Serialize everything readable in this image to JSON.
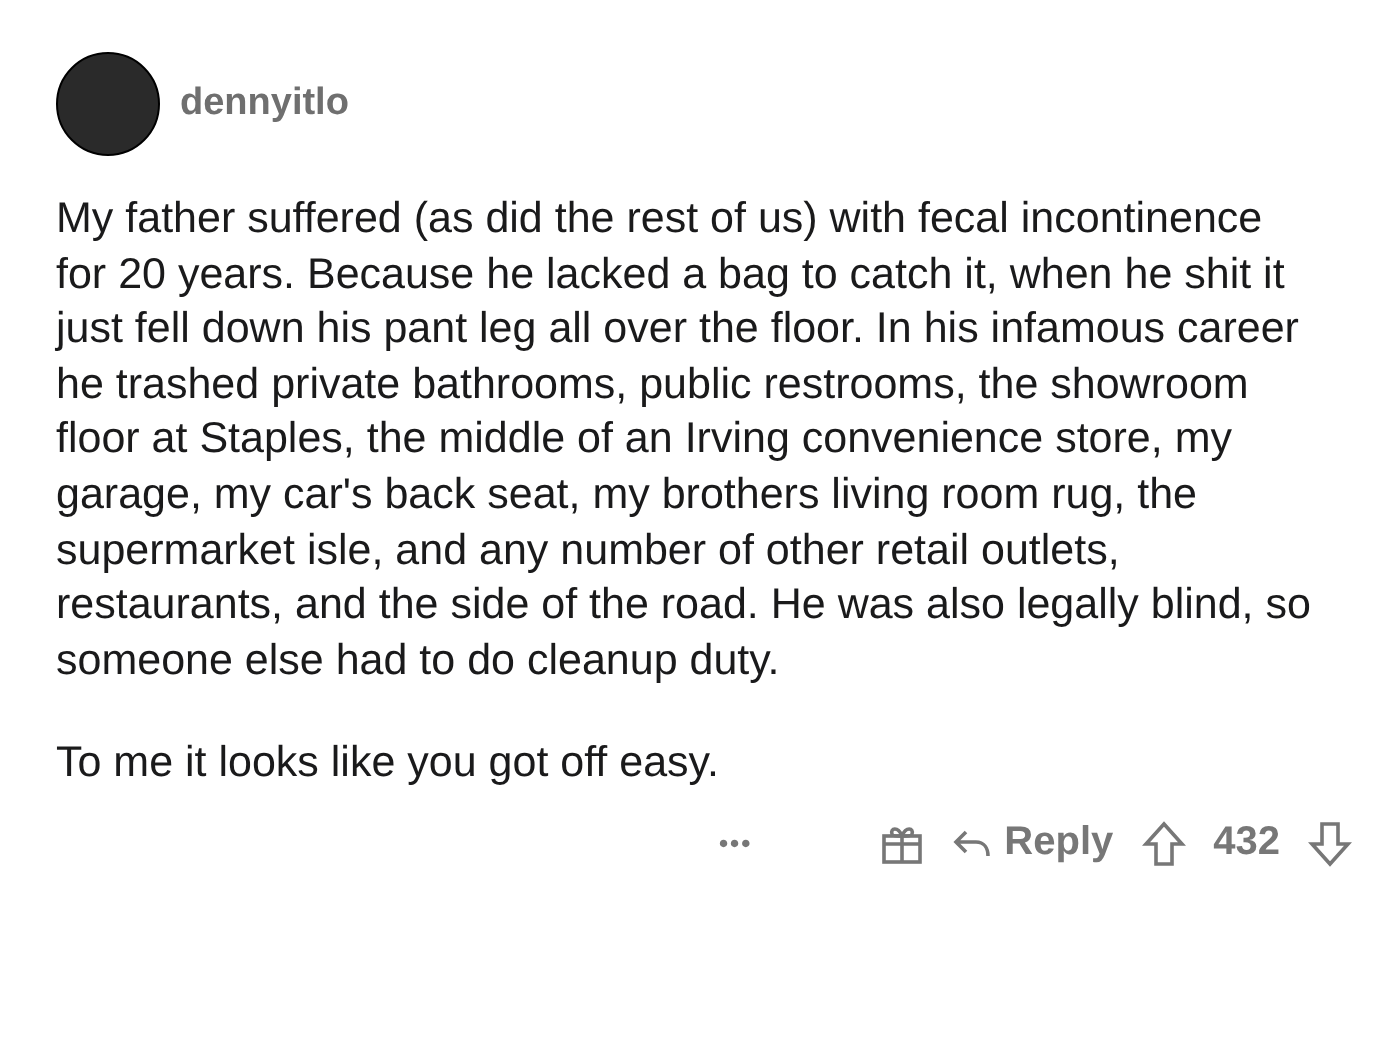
{
  "comment": {
    "username": "dennyitlo",
    "paragraphs": [
      "My father suffered (as did the rest of us) with fecal incontinence for 20 years. Because he lacked a bag to catch it, when he shit it just fell down his pant leg all over the floor. In his infamous career he trashed private bathrooms, public restrooms, the showroom floor at Staples, the middle of an Irving convenience store, my garage, my car's back seat, my brothers living room rug, the supermarket isle, and any number of other retail outlets, restaurants, and the side of the road. He was also legally blind, so someone else had to do cleanup duty.",
      "To me it looks like you got off easy."
    ],
    "actions": {
      "more": "•••",
      "reply": "Reply",
      "score": "432"
    }
  }
}
